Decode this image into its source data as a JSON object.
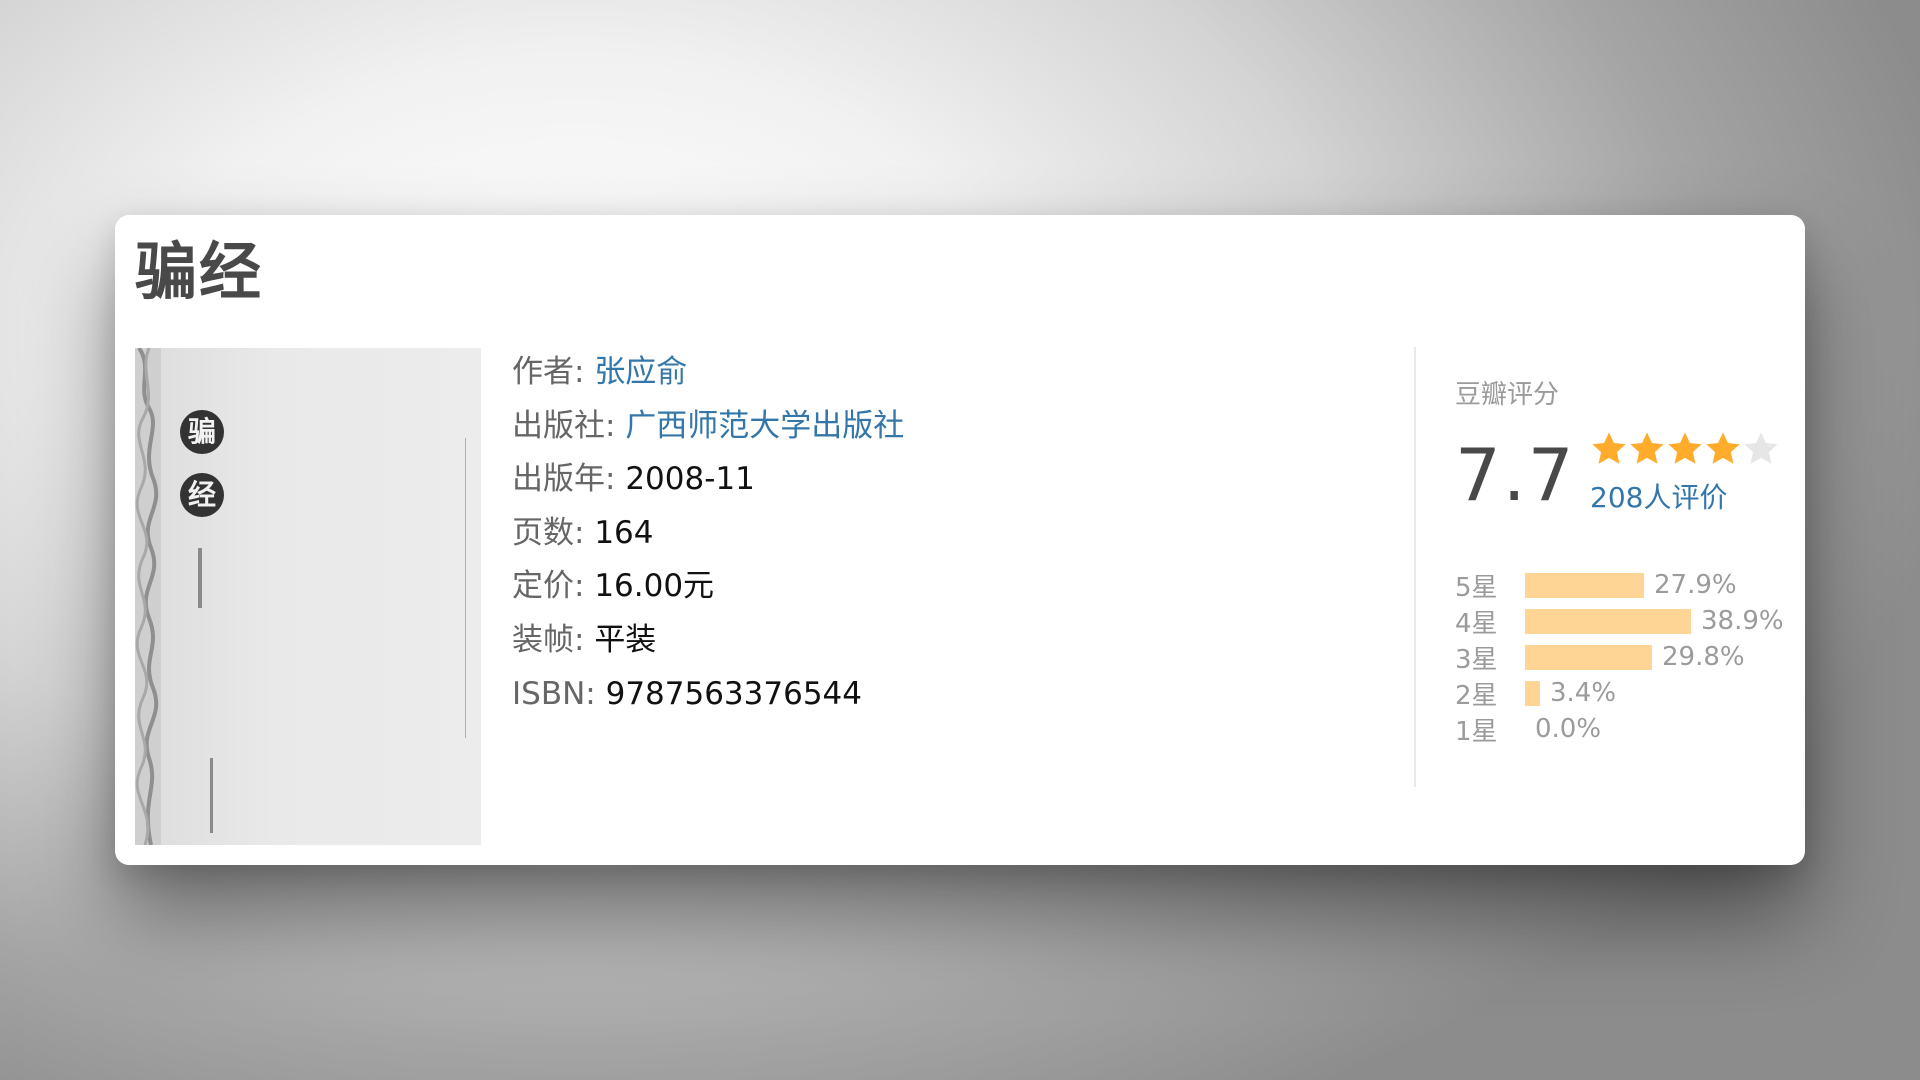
{
  "book": {
    "title": "骗经",
    "cover": {
      "char1": "骗",
      "char2": "经"
    },
    "info": {
      "author_label": "作者:",
      "author": "张应俞",
      "publisher_label": "出版社:",
      "publisher": "广西师范大学出版社",
      "year_label": "出版年:",
      "year": "2008-11",
      "pages_label": "页数:",
      "pages": "164",
      "price_label": "定价:",
      "price": "16.00元",
      "binding_label": "装帧:",
      "binding": "平装",
      "isbn_label": "ISBN:",
      "isbn": "9787563376544"
    }
  },
  "rating": {
    "heading": "豆瓣评分",
    "score": "7.7",
    "stars_filled": 4,
    "stars_total": 5,
    "votes": "208人评价",
    "distribution": [
      {
        "label": "5星",
        "percent_text": "27.9%",
        "percent": 27.9
      },
      {
        "label": "4星",
        "percent_text": "38.9%",
        "percent": 38.9
      },
      {
        "label": "3星",
        "percent_text": "29.8%",
        "percent": 29.8
      },
      {
        "label": "2星",
        "percent_text": "3.4%",
        "percent": 3.4
      },
      {
        "label": "1星",
        "percent_text": "0.0%",
        "percent": 0.0
      }
    ]
  },
  "colors": {
    "link": "#3377aa",
    "star_filled": "#ffac2d",
    "star_empty": "#e6e6e6",
    "bar": "#ffd596"
  },
  "icons": {
    "star_filled": "star-filled-icon",
    "star_empty": "star-empty-icon"
  }
}
